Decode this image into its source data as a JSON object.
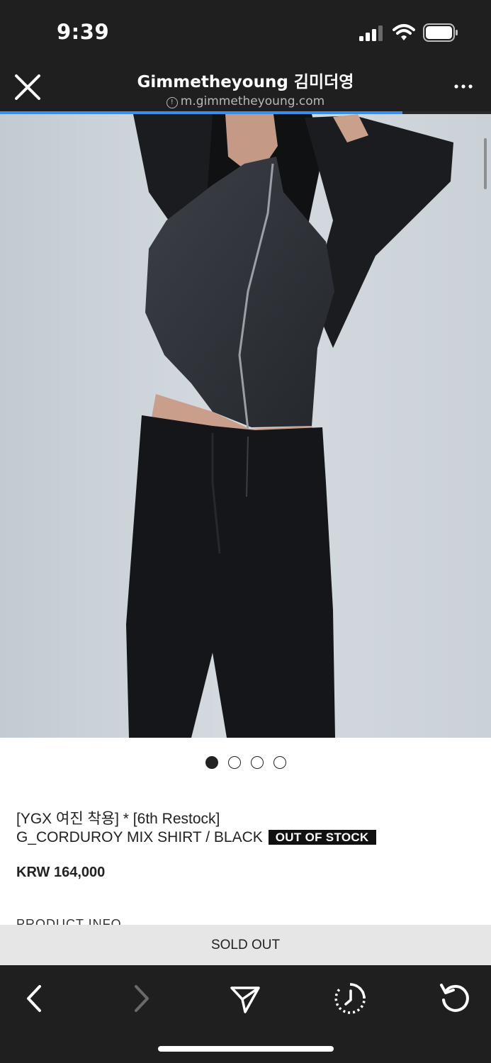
{
  "status_bar": {
    "time": "9:39"
  },
  "browser": {
    "title": "Gimmetheyoung 김미더영",
    "url": "m.gimmetheyoung.com",
    "load_progress": 0.82,
    "close_icon": "close-icon",
    "more_icon": "more-horizontal-icon",
    "accent_color": "#3b8ee8"
  },
  "carousel": {
    "count": 4,
    "active_index": 0
  },
  "product": {
    "title_line1": "[YGX 여진 착용] * [6th Restock]",
    "title_line2": "G_CORDUROY MIX SHIRT / BLACK",
    "badge": "OUT OF STOCK",
    "price": "KRW 164,000",
    "section_heading": "PRODUCT INFO"
  },
  "action": {
    "sold_out_label": "SOLD OUT"
  },
  "toolbar": {
    "buttons": [
      "back-icon",
      "forward-icon",
      "share-send-icon",
      "history-clock-icon",
      "reload-icon"
    ]
  }
}
